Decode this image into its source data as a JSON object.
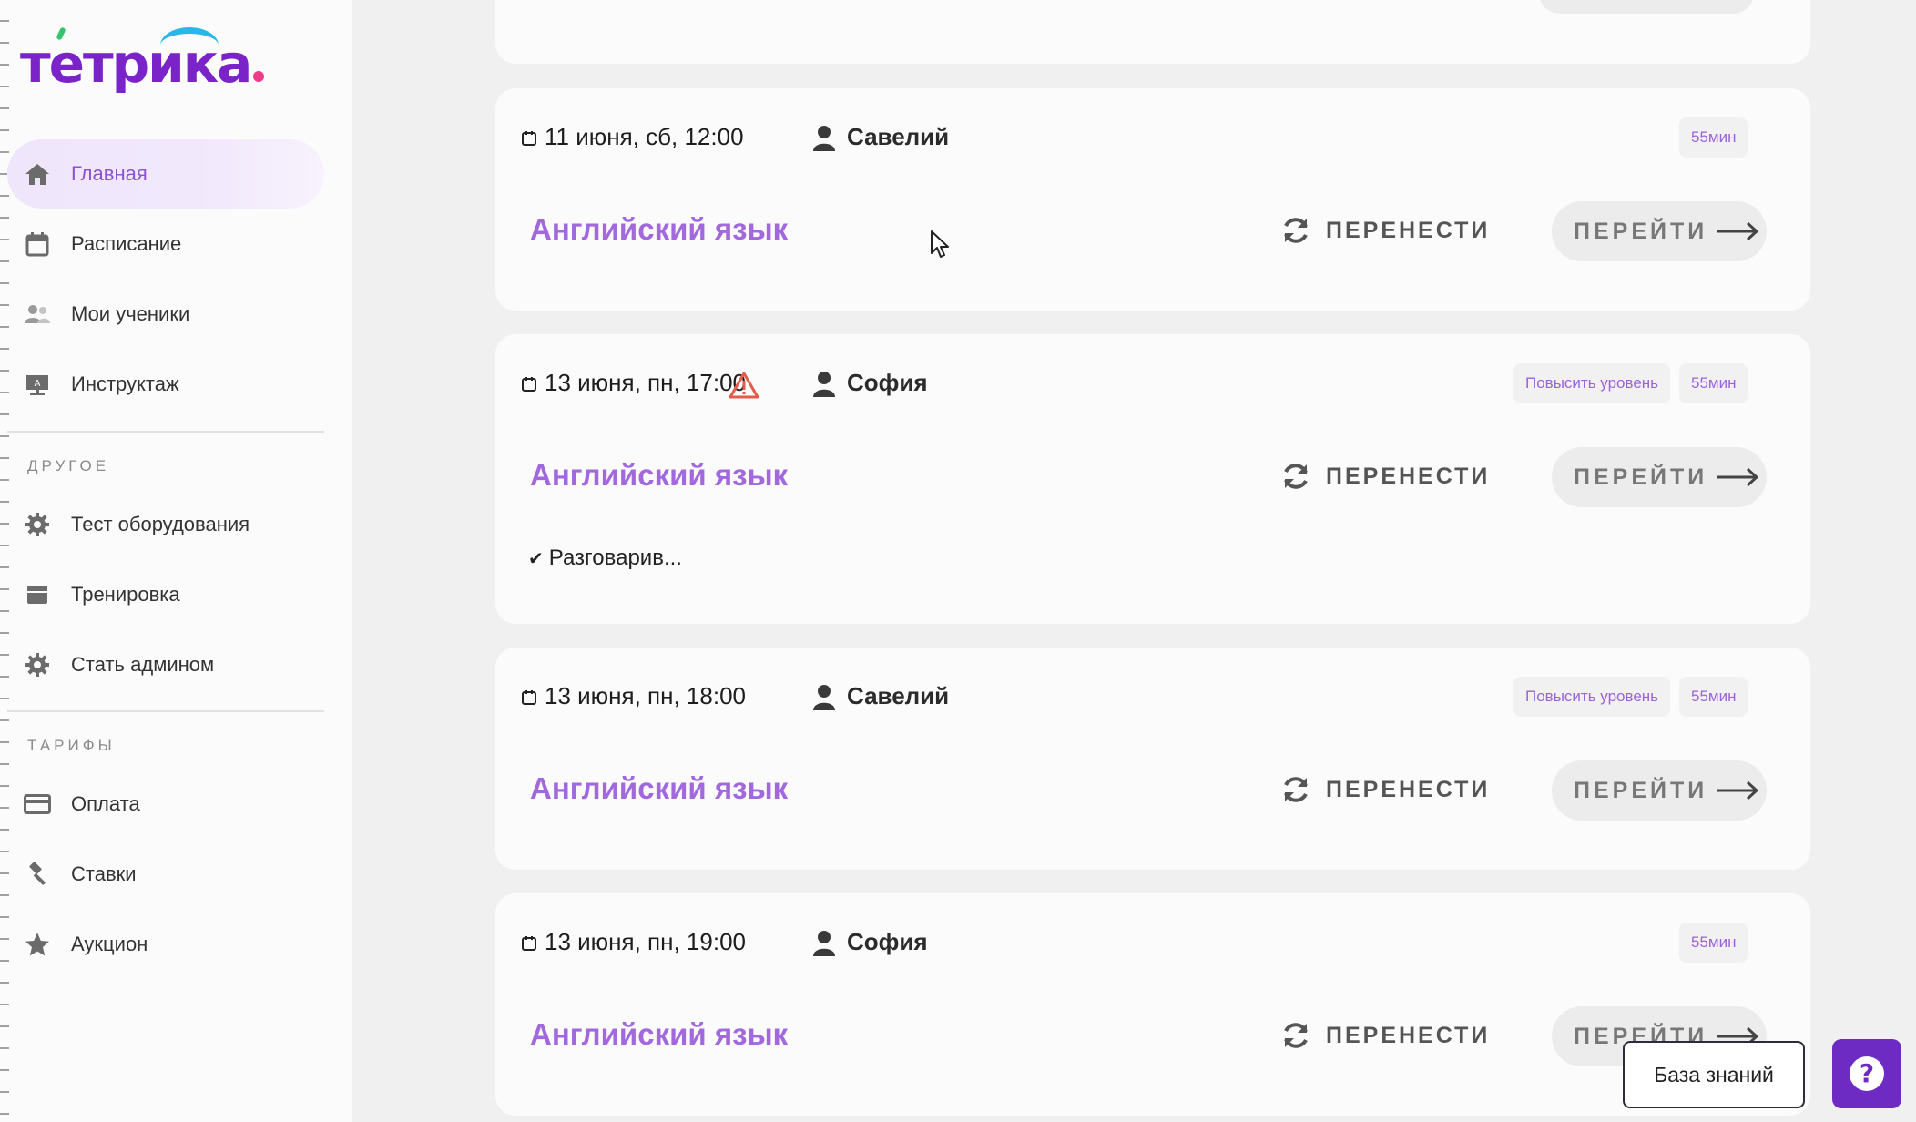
{
  "app": {
    "logo_text": "тетрика"
  },
  "sidebar": {
    "main_items": [
      {
        "label": "Главная",
        "icon": "home-icon"
      },
      {
        "label": "Расписание",
        "icon": "calendar-icon"
      },
      {
        "label": "Мои ученики",
        "icon": "students-icon"
      },
      {
        "label": "Инструктаж",
        "icon": "presentation-icon"
      }
    ],
    "section_other": "ДРУГОЕ",
    "other_items": [
      {
        "label": "Тест оборудования",
        "icon": "gear-icon"
      },
      {
        "label": "Тренировка",
        "icon": "window-icon"
      },
      {
        "label": "Стать админом",
        "icon": "gear-icon"
      }
    ],
    "section_tariffs": "ТАРИФЫ",
    "tariff_items": [
      {
        "label": "Оплата",
        "icon": "credit-card-icon"
      },
      {
        "label": "Ставки",
        "icon": "gavel-icon"
      },
      {
        "label": "Аукцион",
        "icon": "star-icon"
      }
    ]
  },
  "lessons": [
    {
      "date": "11 июня, сб, 12:00",
      "student": "Савелий",
      "subject": "Английский язык",
      "duration": "55мин",
      "reschedule": "ПЕРЕНЕСТИ",
      "goto": "ПЕРЕЙТИ"
    },
    {
      "date": "13 июня, пн, 17:00",
      "student": "София",
      "subject": "Английский язык",
      "duration": "55мин",
      "level_badge": "Повысить уровень",
      "reschedule": "ПЕРЕНЕСТИ",
      "goto": "ПЕРЕЙТИ",
      "note": "Разговарив...",
      "warning": "warning-icon"
    },
    {
      "date": "13 июня, пн, 18:00",
      "student": "Савелий",
      "subject": "Английский язык",
      "duration": "55мин",
      "level_badge": "Повысить уровень",
      "reschedule": "ПЕРЕНЕСТИ",
      "goto": "ПЕРЕЙТИ"
    },
    {
      "date": "13 июня, пн, 19:00",
      "student": "София",
      "subject": "Английский язык",
      "duration": "55мин",
      "reschedule": "ПЕРЕНЕСТИ",
      "goto": "ПЕРЕЙТИ"
    }
  ],
  "footer": {
    "knowledge_base": "База знаний",
    "help_icon": "question-icon"
  },
  "colors": {
    "accent": "#a268de",
    "brand": "#7a23c8",
    "help_button": "#6d2bc4"
  }
}
